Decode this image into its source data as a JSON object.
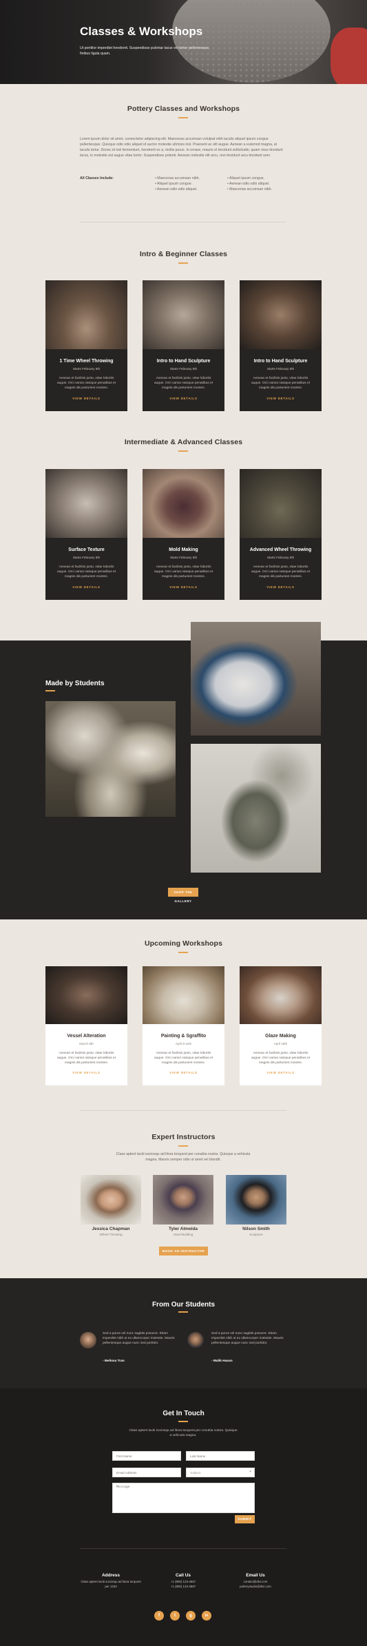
{
  "hero": {
    "title": "Classes & Workshops",
    "subtitle": "Ut porttitor imperdiet hendrerit. Suspendisse pulvinar lacus vel tortor pellentesque, finibus ligula quam."
  },
  "intro": {
    "heading": "Pottery Classes and Workshops",
    "paragraph": "Lorem ipsum dolor sit amet, consectetur adipiscing elit. Maecenas accumsan volutpat nibh iaculis aliquet ipsum congue pellentesque. Quisque odio odio aliquet id auctor molestie ultricies nisl. Praesent ac elit augue. Aenean a euismod magna, at iaculis tortor. Donec id nisl fermentum, hendrerit ex a, mollis purus. In ornare, mauris et tincidunt sollicitudin, quam risus tincidunt lacus, in molestie est augue vitae tortor. Suspendisse potenti. Aenean molestie elit arcu, non tincidunt arcu tincidunt sem.",
    "includes_label": "All Classes Include:",
    "list_col1": [
      "Maecenas accumsan nibh.",
      "Aliquet ipsum congue.",
      "Aenean odio odio aliquet."
    ],
    "list_col2": [
      "Aliquet ipsum congue.",
      "Aenean odio odio aliquet.",
      "Maecenas accumsan nibh."
    ]
  },
  "beginner": {
    "heading": "Intro & Beginner Classes",
    "cards": [
      {
        "title": "1 Time Wheel Throwing",
        "date": "Starts February 8th",
        "text": "Aenean et facilisis justo, vitae lobortis augue. Orci varius natoque penatibus et magnis dis parturient montes.",
        "link": "VIEW DETAILS"
      },
      {
        "title": "Intro to Hand Sculpture",
        "date": "Starts February 8th",
        "text": "Aenean et facilisis justo, vitae lobortis augue. Orci varius natoque penatibus et magnis dis parturient montes.",
        "link": "VIEW DETAILS"
      },
      {
        "title": "Intro to Hand Sculpture",
        "date": "Starts February 8th",
        "text": "Aenean et facilisis justo, vitae lobortis augue. Orci varius natoque penatibus et magnis dis parturient montes.",
        "link": "VIEW DETAILS"
      }
    ]
  },
  "advanced": {
    "heading": "Intermediate & Advanced Classes",
    "cards": [
      {
        "title": "Surface Texture",
        "date": "Starts February 8th",
        "text": "Aenean et facilisis justo, vitae lobortis augue. Orci varius natoque penatibus et magnis dis parturient montes.",
        "link": "VIEW DETAILS"
      },
      {
        "title": "Mold Making",
        "date": "Starts February 8th",
        "text": "Aenean et facilisis justo, vitae lobortis augue. Orci varius natoque penatibus et magnis dis parturient montes.",
        "link": "VIEW DETAILS"
      },
      {
        "title": "Advanced Wheel Throwing",
        "date": "Starts February 8th",
        "text": "Aenean et facilisis justo, vitae lobortis augue. Orci varius natoque penatibus et magnis dis parturient montes.",
        "link": "VIEW DETAILS"
      }
    ]
  },
  "students_gallery": {
    "heading": "Made by Students",
    "button": "SHOP THE GALLERY"
  },
  "workshops": {
    "heading": "Upcoming Workshops",
    "cards": [
      {
        "title": "Vessel Alteration",
        "date": "March 5th",
        "text": "Aenean et facilisis justo, vitae lobortis augue. Orci varius natoque penatibus et magnis dis parturient montes.",
        "link": "VIEW DETAILS"
      },
      {
        "title": "Painting & Sgraffito",
        "date": "April 8-11th",
        "text": "Aenean et facilisis justo, vitae lobortis augue. Orci varius natoque penatibus et magnis dis parturient montes.",
        "link": "VIEW DETAILS"
      },
      {
        "title": "Glaze Making",
        "date": "April 18th",
        "text": "Aenean et facilisis justo, vitae lobortis augue. Orci varius natoque penatibus et magnis dis parturient montes.",
        "link": "VIEW DETAILS"
      }
    ]
  },
  "instructors": {
    "heading": "Expert Instructors",
    "text": "Class aptent taciti sociosqu ad litora torquent per conubia nostra. Quisque a vehicula magna. Mauris semper odio ut amet vel blandit.",
    "people": [
      {
        "name": "Jessica Chapman",
        "role": "Wheel Throwing"
      },
      {
        "name": "Tyler Almeida",
        "role": "Hand Building"
      },
      {
        "name": "Nilson Smith",
        "role": "Sculpture"
      }
    ],
    "button": "BOOK AN INSTRUCTOR"
  },
  "testimonials": {
    "heading": "From Our Students",
    "items": [
      {
        "quote": "Sed a purus vel nunc sagittis posuere. Etiam imperdiet nibh ut ex ullamcorper molestie. Mauris pellentesque augue nunc sed porttitor.",
        "name": "- Melissa Tran"
      },
      {
        "quote": "Sed a purus vel nunc sagittis posuere. Etiam imperdiet nibh ut ex ullamcorper molestie. Mauris pellentesque augue nunc sed porttitor.",
        "name": "- Malik Hasan"
      }
    ]
  },
  "contact": {
    "heading": "Get In Touch",
    "text": "Class aptent taciti sociosqu ad litora torquent per conubia nostra. Quisque a vehicula magna.",
    "first_name": "First Name",
    "last_name": "Last Name",
    "email": "Email Address",
    "subject": "Subject",
    "message": "Message",
    "submit": "SUBMIT"
  },
  "footer": {
    "address_title": "Address",
    "address_text": "Class aptent taciti sociosqu ad litora torquent per 1234",
    "call_title": "Call Us",
    "call_text": "+1 (800) 123-4567\n+1 (800) 123-4567",
    "email_title": "Email Us",
    "email_text": "contact@divi.com\npotterystudio@divi.com",
    "social": [
      "f",
      "t",
      "g",
      "in"
    ]
  },
  "colors": {
    "accent": "#e5a24f",
    "dark": "#262422",
    "light": "#ece6e0"
  }
}
